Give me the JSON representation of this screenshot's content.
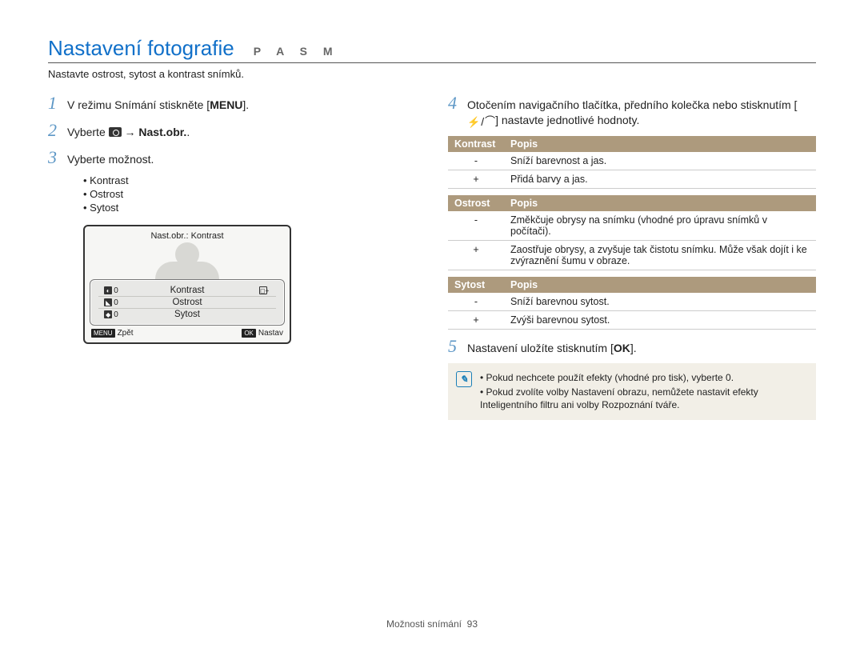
{
  "header": {
    "title": "Nastavení fotografie",
    "mode": "P A S M"
  },
  "intro": "Nastavte ostrost, sytost a kontrast snímků.",
  "steps": {
    "s1_pre": "V režimu Snímání stiskněte [",
    "s1_menu": "MENU",
    "s1_post": "].",
    "s2_pre": "Vyberte ",
    "s2_arrow": " → ",
    "s2_target": "Nast.obr.",
    "s2_post": ".",
    "s3": "Vyberte možnost.",
    "bullets": [
      "Kontrast",
      "Ostrost",
      "Sytost"
    ],
    "s4_pre": "Otočením navigačního tlačítka, předního kolečka nebo stisknutím [",
    "s4_post": "] nastavte jednotlivé hodnoty.",
    "s5_pre": "Nastavení uložíte stisknutím [",
    "s5_ok": "OK",
    "s5_post": "]."
  },
  "lcd": {
    "title": "Nast.obr.: Kontrast",
    "rows": [
      {
        "left_badge": "◐",
        "left_val": "0",
        "label": "Kontrast",
        "right": "◻+"
      },
      {
        "left_badge": "◣",
        "left_val": "0",
        "label": "Ostrost",
        "right": ""
      },
      {
        "left_badge": "◆",
        "left_val": "0",
        "label": "Sytost",
        "right": ""
      }
    ],
    "back_tag": "MENU",
    "back": "Zpět",
    "set_tag": "OK",
    "set": "Nastav"
  },
  "tables": [
    {
      "h1": "Kontrast",
      "h2": "Popis",
      "rows": [
        {
          "sign": "-",
          "desc": "Sníží barevnost a jas."
        },
        {
          "sign": "+",
          "desc": "Přidá barvy a jas."
        }
      ]
    },
    {
      "h1": "Ostrost",
      "h2": "Popis",
      "rows": [
        {
          "sign": "-",
          "desc": "Změkčuje obrysy na snímku (vhodné pro úpravu snímků v počítači)."
        },
        {
          "sign": "+",
          "desc": "Zaostřuje obrysy, a zvyšuje tak čistotu snímku. Může však dojít i ke zvýraznění šumu v obraze."
        }
      ]
    },
    {
      "h1": "Sytost",
      "h2": "Popis",
      "rows": [
        {
          "sign": "-",
          "desc": "Sníží barevnou sytost."
        },
        {
          "sign": "+",
          "desc": "Zvýši barevnou sytost."
        }
      ]
    }
  ],
  "notes": [
    "Pokud nechcete použít efekty (vhodné pro tisk), vyberte 0.",
    "Pokud zvolíte volby Nastavení obrazu, nemůžete nastavit efekty Inteligentního filtru ani volby Rozpoznání tváře."
  ],
  "footer": {
    "section": "Možnosti snímání",
    "page": "93"
  }
}
